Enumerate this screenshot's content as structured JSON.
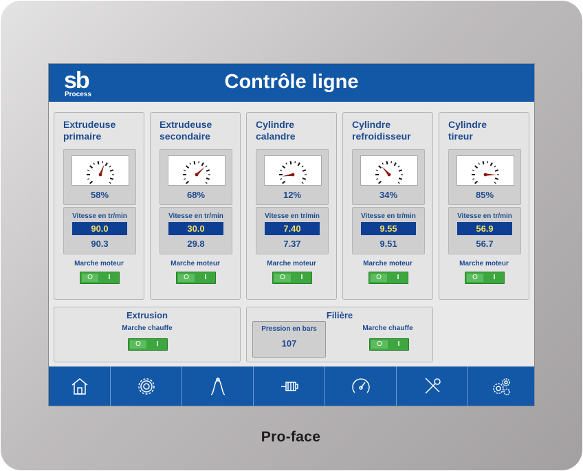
{
  "device": {
    "brand": "Pro-face"
  },
  "header": {
    "logo_text": "sb",
    "logo_subtext": "Process",
    "title": "Contrôle ligne"
  },
  "units": [
    {
      "title_line1": "Extrudeuse",
      "title_line2": "primaire",
      "gauge_percent": 58,
      "percent_text": "58%",
      "speed_label": "Vitesse en tr/min",
      "setpoint": "90.0",
      "actual": "90.3",
      "motor_label": "Marche moteur",
      "toggle_off": "O",
      "toggle_on": "I"
    },
    {
      "title_line1": "Extrudeuse",
      "title_line2": "secondaire",
      "gauge_percent": 68,
      "percent_text": "68%",
      "speed_label": "Vitesse en tr/min",
      "setpoint": "30.0",
      "actual": "29.8",
      "motor_label": "Marche moteur",
      "toggle_off": "O",
      "toggle_on": "I"
    },
    {
      "title_line1": "Cylindre",
      "title_line2": "calandre",
      "gauge_percent": 12,
      "percent_text": "12%",
      "speed_label": "Vitesse en tr/min",
      "setpoint": "7.40",
      "actual": "7.37",
      "motor_label": "Marche moteur",
      "toggle_off": "O",
      "toggle_on": "I"
    },
    {
      "title_line1": "Cylindre",
      "title_line2": "refroidisseur",
      "gauge_percent": 34,
      "percent_text": "34%",
      "speed_label": "Vitesse en tr/min",
      "setpoint": "9.55",
      "actual": "9.51",
      "motor_label": "Marche moteur",
      "toggle_off": "O",
      "toggle_on": "I"
    },
    {
      "title_line1": "Cylindre",
      "title_line2": "tireur",
      "gauge_percent": 85,
      "percent_text": "85%",
      "speed_label": "Vitesse en tr/min",
      "setpoint": "56.9",
      "actual": "56.7",
      "motor_label": "Marche moteur",
      "toggle_off": "O",
      "toggle_on": "I"
    }
  ],
  "extrusion": {
    "title": "Extrusion",
    "heat_label": "Marche chauffe",
    "toggle_off": "O",
    "toggle_on": "I"
  },
  "filiere": {
    "title": "Filière",
    "pressure_label": "Pression en bars",
    "pressure_value": "107",
    "heat_label": "Marche chauffe",
    "toggle_off": "O",
    "toggle_on": "I"
  },
  "nav": [
    "home-icon",
    "settings-gear-icon",
    "curve-icon",
    "motor-icon",
    "speedometer-icon",
    "tools-icon",
    "gears-icon"
  ],
  "colors": {
    "header_blue": "#1358a6",
    "text_blue": "#1d4a8f",
    "setpoint_bg": "#0f3f95",
    "setpoint_text": "#f3e05c",
    "toggle_green": "#3da63e",
    "needle": "#8b1a0f"
  }
}
